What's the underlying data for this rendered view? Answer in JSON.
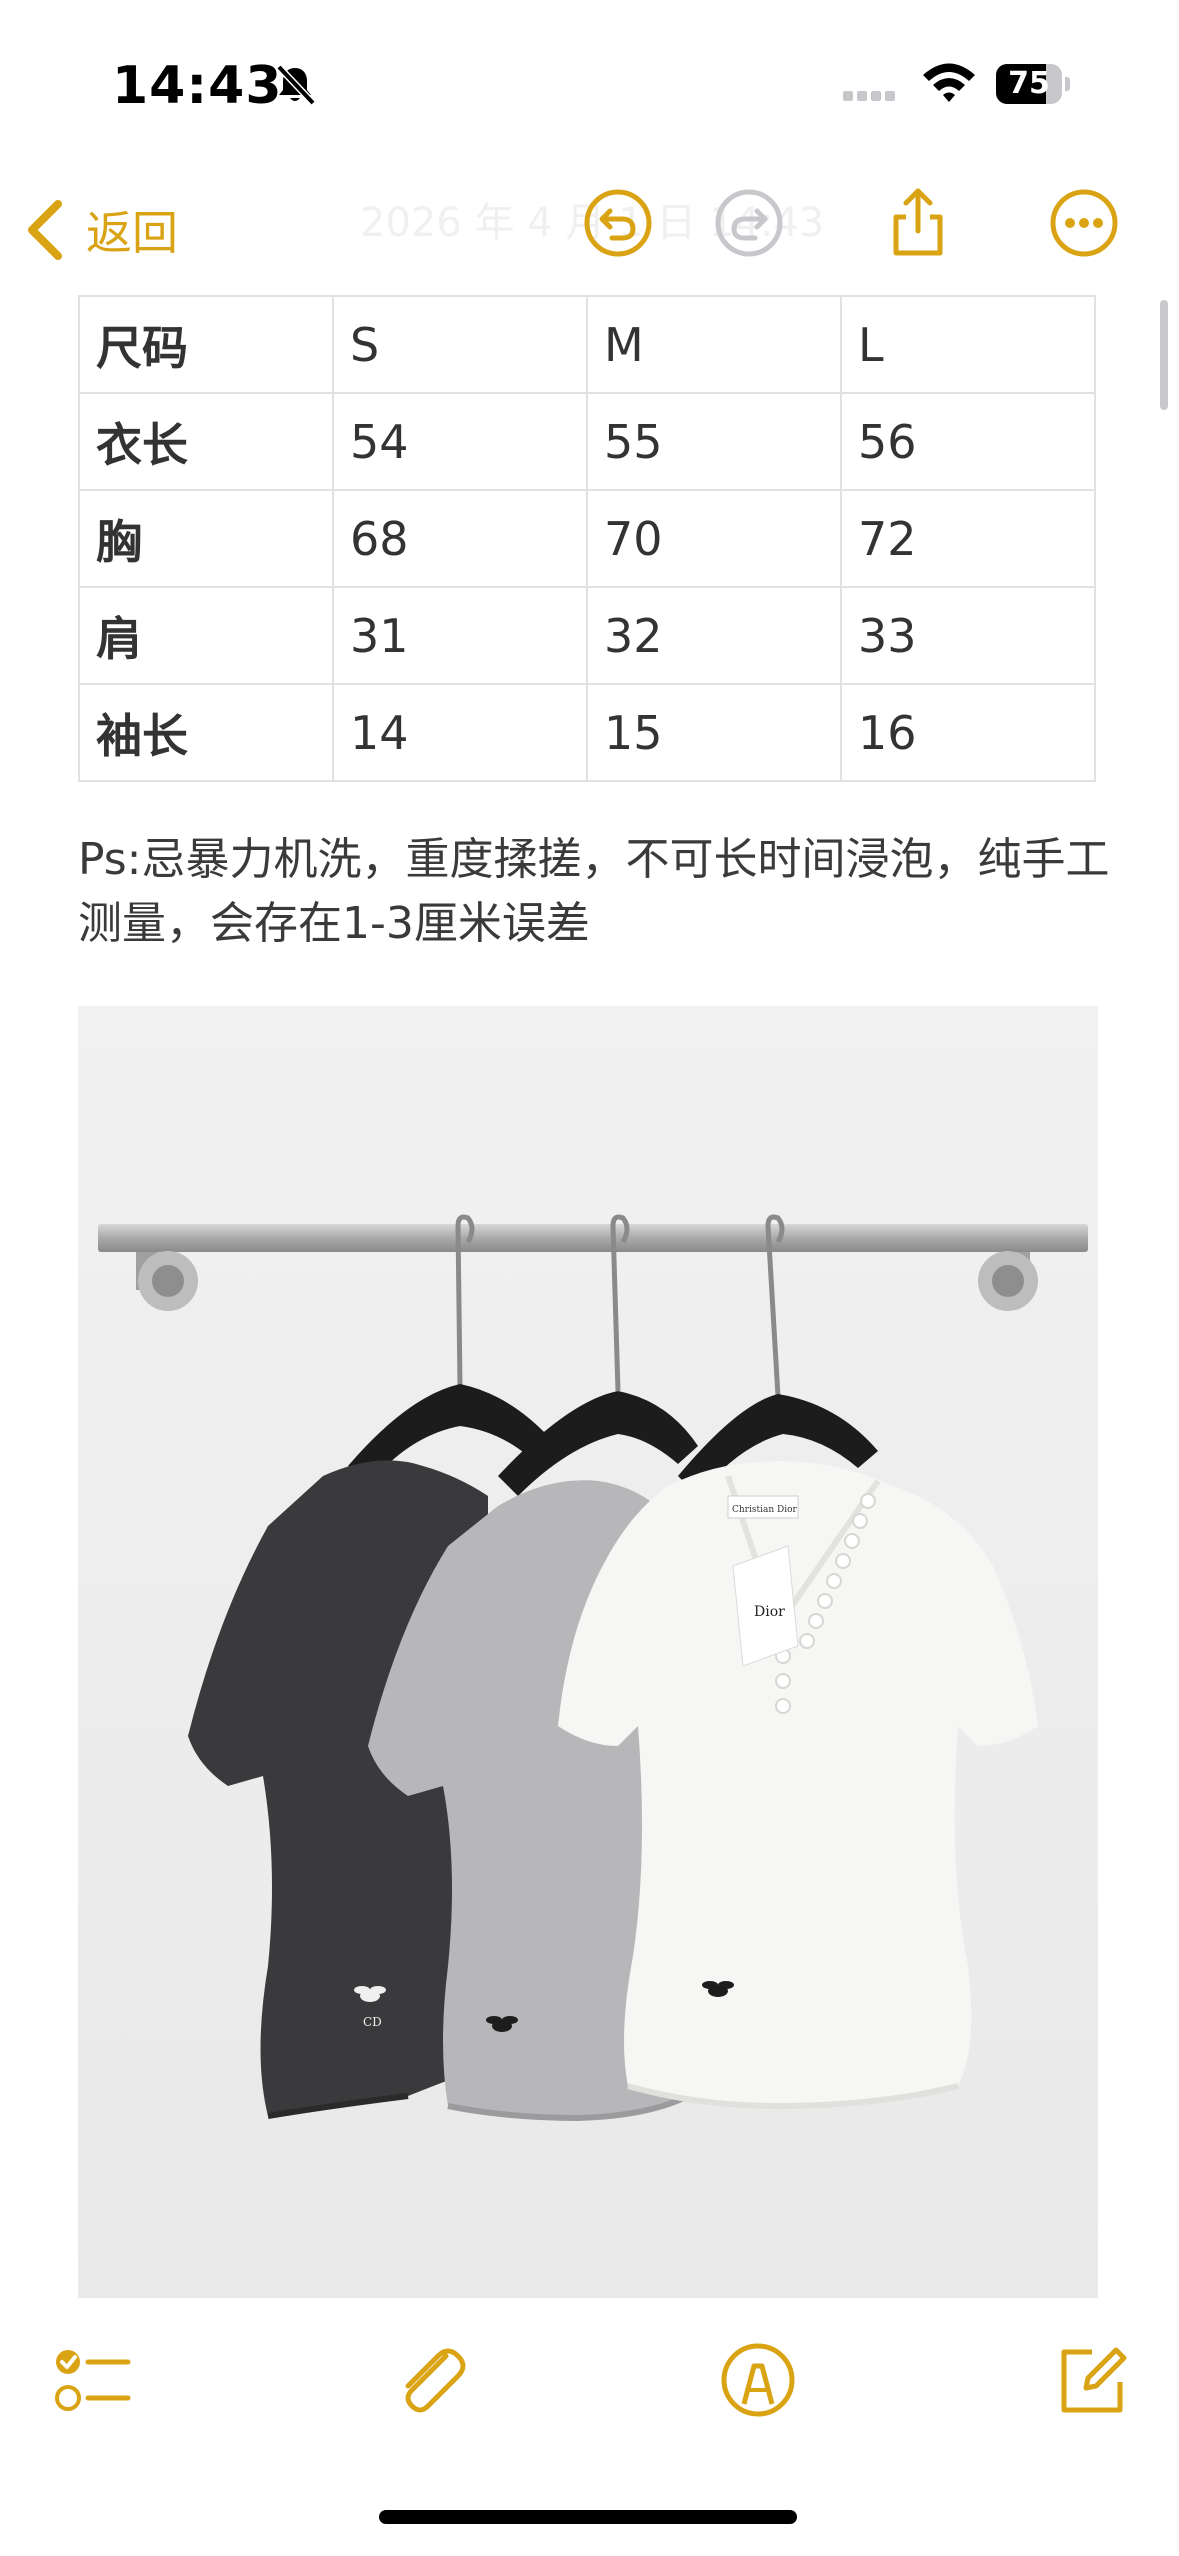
{
  "status_bar": {
    "time": "14:43",
    "battery_percent": "75",
    "battery_level": 0.75,
    "icons": [
      "bell-slash-icon",
      "cellular-signal-icon",
      "wifi-icon",
      "battery-icon"
    ]
  },
  "nav": {
    "back_label": "返回",
    "title": "2026 年 4 月 1 日 14:43",
    "icons": [
      "chevron-left-icon",
      "undo-icon",
      "redo-icon",
      "share-icon",
      "more-icon"
    ]
  },
  "size_table": {
    "rows": [
      [
        "尺码",
        "S",
        "M",
        "L"
      ],
      [
        "衣长",
        "54",
        "55",
        "56"
      ],
      [
        "胸",
        "68",
        "70",
        "72"
      ],
      [
        "肩",
        "31",
        "32",
        "33"
      ],
      [
        "袖长",
        "14",
        "15",
        "16"
      ]
    ]
  },
  "note": {
    "text": "Ps:忌暴力机洗，重度揉搓，不可长时间浸泡，纯手工测量，会存在1-3厘米误差"
  },
  "photo": {
    "label_text": "Christian Dior",
    "embroidery_text": "CD",
    "tag_text": "Dior"
  },
  "toolbar": {
    "icons": [
      "checklist-icon",
      "paperclip-icon",
      "markup-pen-icon",
      "compose-icon"
    ]
  },
  "colors": {
    "accent": "#d9a313",
    "text": "#3a3a3c",
    "table_border": "#e1e1e1",
    "disabled": "#c7c7cc"
  }
}
